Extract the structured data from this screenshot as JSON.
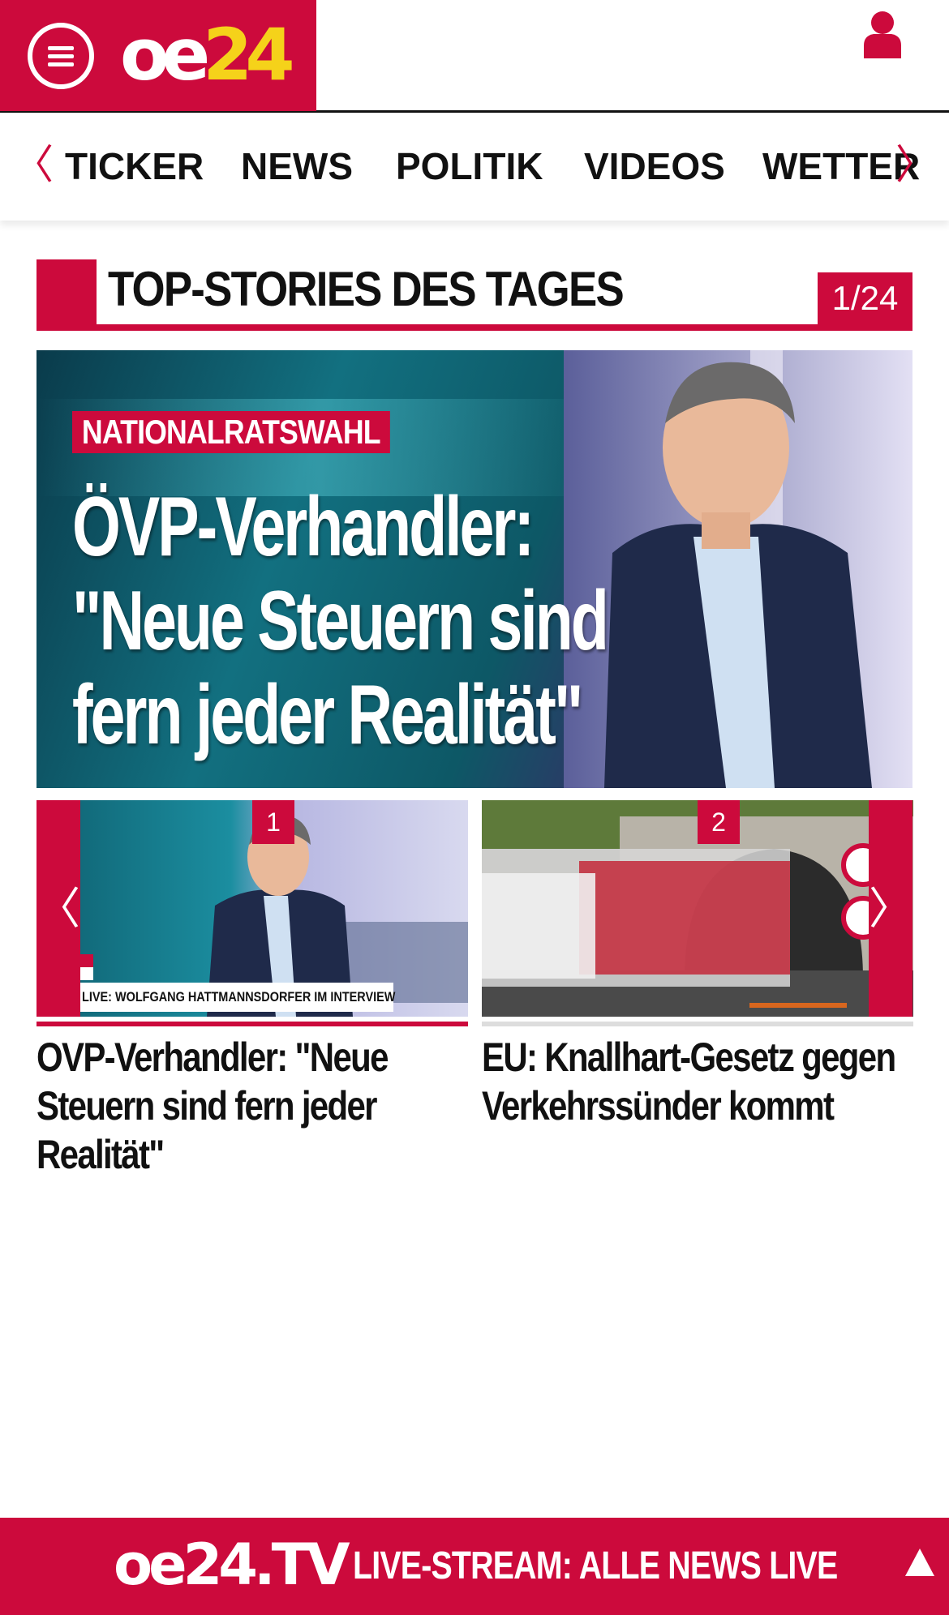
{
  "header": {
    "logo_oe": "oe",
    "logo_num": "24",
    "menu_icon": "hamburger-menu-icon",
    "user_icon": "user-icon"
  },
  "nav": {
    "items": [
      {
        "label": "TICKER"
      },
      {
        "label": "NEWS"
      },
      {
        "label": "POLITIK"
      },
      {
        "label": "VIDEOS"
      },
      {
        "label": "WETTER"
      }
    ],
    "prev_arrow": "〈",
    "next_arrow": "〉"
  },
  "section": {
    "title": "TOP-STORIES DES TAGES",
    "counter": "1/24"
  },
  "hero": {
    "kicker": "NATIONALRATSWAHL",
    "headline": "ÖVP-Verhandler: \"Neue Steuern sind fern jeder Realität\""
  },
  "carousel": {
    "prev_arrow": "〈",
    "next_arrow": "〉",
    "cards": [
      {
        "number": "1",
        "caption": "LIVE: WOLFGANG HATTMANNSDORFER IM INTERVIEW",
        "title": "OVP-Verhandler: \"Neue Steuern sind fern jeder Realität\""
      },
      {
        "number": "2",
        "title": "EU: Knallhart-Gesetz gegen Verkehrssünder kommt"
      }
    ]
  },
  "footer": {
    "tv_logo": "oe24.TV",
    "label": "LIVE-STREAM:  ALLE NEWS LIVE"
  },
  "colors": {
    "brand_red": "#cc0a3c",
    "logo_yellow": "#f5d21a"
  }
}
